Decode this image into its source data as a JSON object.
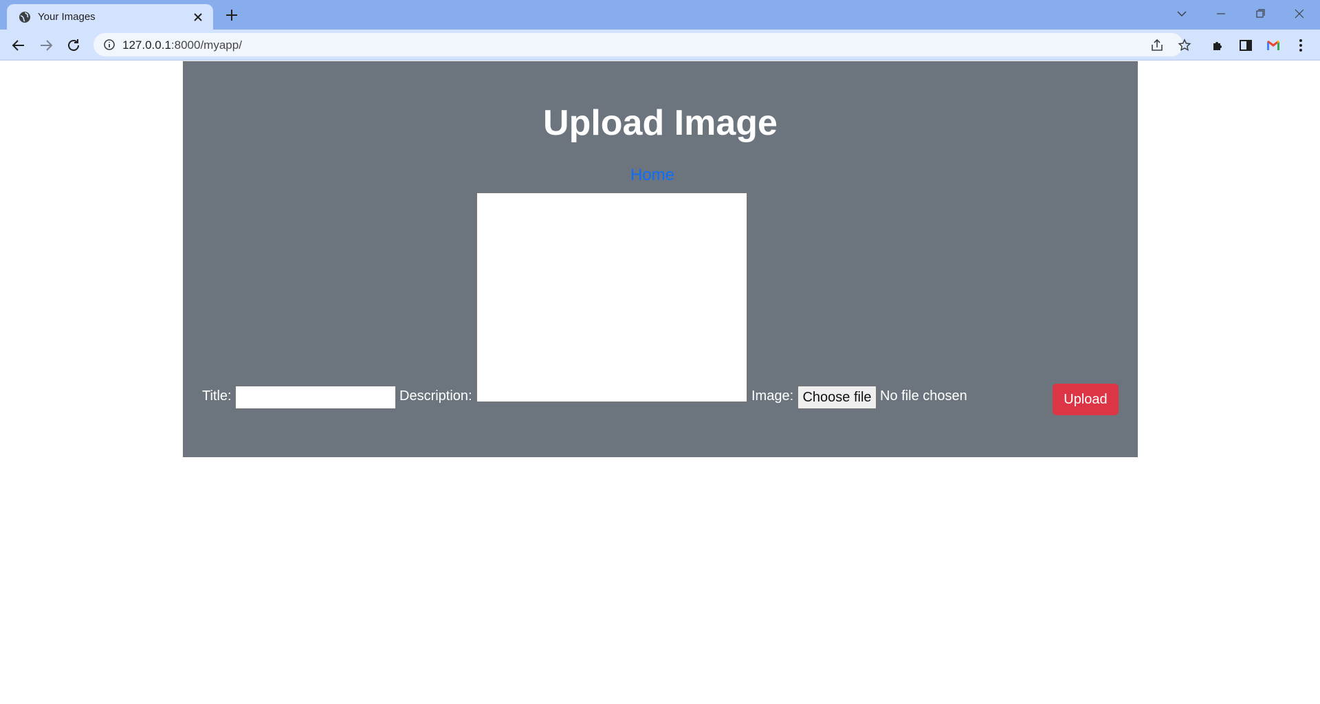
{
  "browser": {
    "tab": {
      "title": "Your Images"
    },
    "address": {
      "host": "127.0.0.1",
      "rest": ":8000/myapp/"
    }
  },
  "page": {
    "title": "Upload Image",
    "home_link": "Home",
    "form": {
      "title_label": "Title:",
      "title_value": "",
      "description_label": "Description:",
      "description_value": "",
      "image_label": "Image:",
      "choose_file_label": "Choose file",
      "file_status": "No file chosen",
      "upload_label": "Upload"
    }
  },
  "colors": {
    "page_background": "#6c757d",
    "link": "#0d6efd",
    "upload_button": "#dc3545",
    "tabstrip": "#87aded",
    "toolbar": "#d3e3fd"
  }
}
